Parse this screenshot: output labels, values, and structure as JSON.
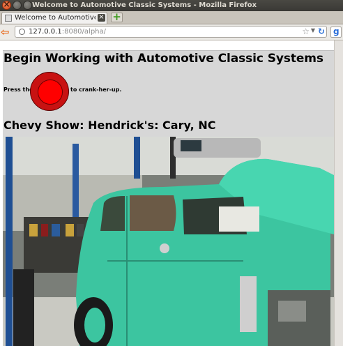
{
  "window": {
    "title": "Welcome to Automotive Classic Systems - Mozilla Firefox"
  },
  "tabs": [
    {
      "label": "Welcome to Automotive Classic..."
    }
  ],
  "address": {
    "host": "127.0.0.1",
    "rest": ":8080/alpha/"
  },
  "page": {
    "heading": "Begin Working with Automotive Classic Systems",
    "press_label": "Press the",
    "crank_label": "to crank-her-up.",
    "show_title": "Chevy Show: Hendrick's: Cary, NC"
  },
  "photo": {
    "car_color": "#3cc5a0",
    "floor_color": "#c9c9c2",
    "lift_color": "#1f4f93"
  },
  "colors": {
    "panel_bg": "#d7d7d7",
    "button_red": "#ff0000",
    "titlebar": "#3c3b37"
  }
}
